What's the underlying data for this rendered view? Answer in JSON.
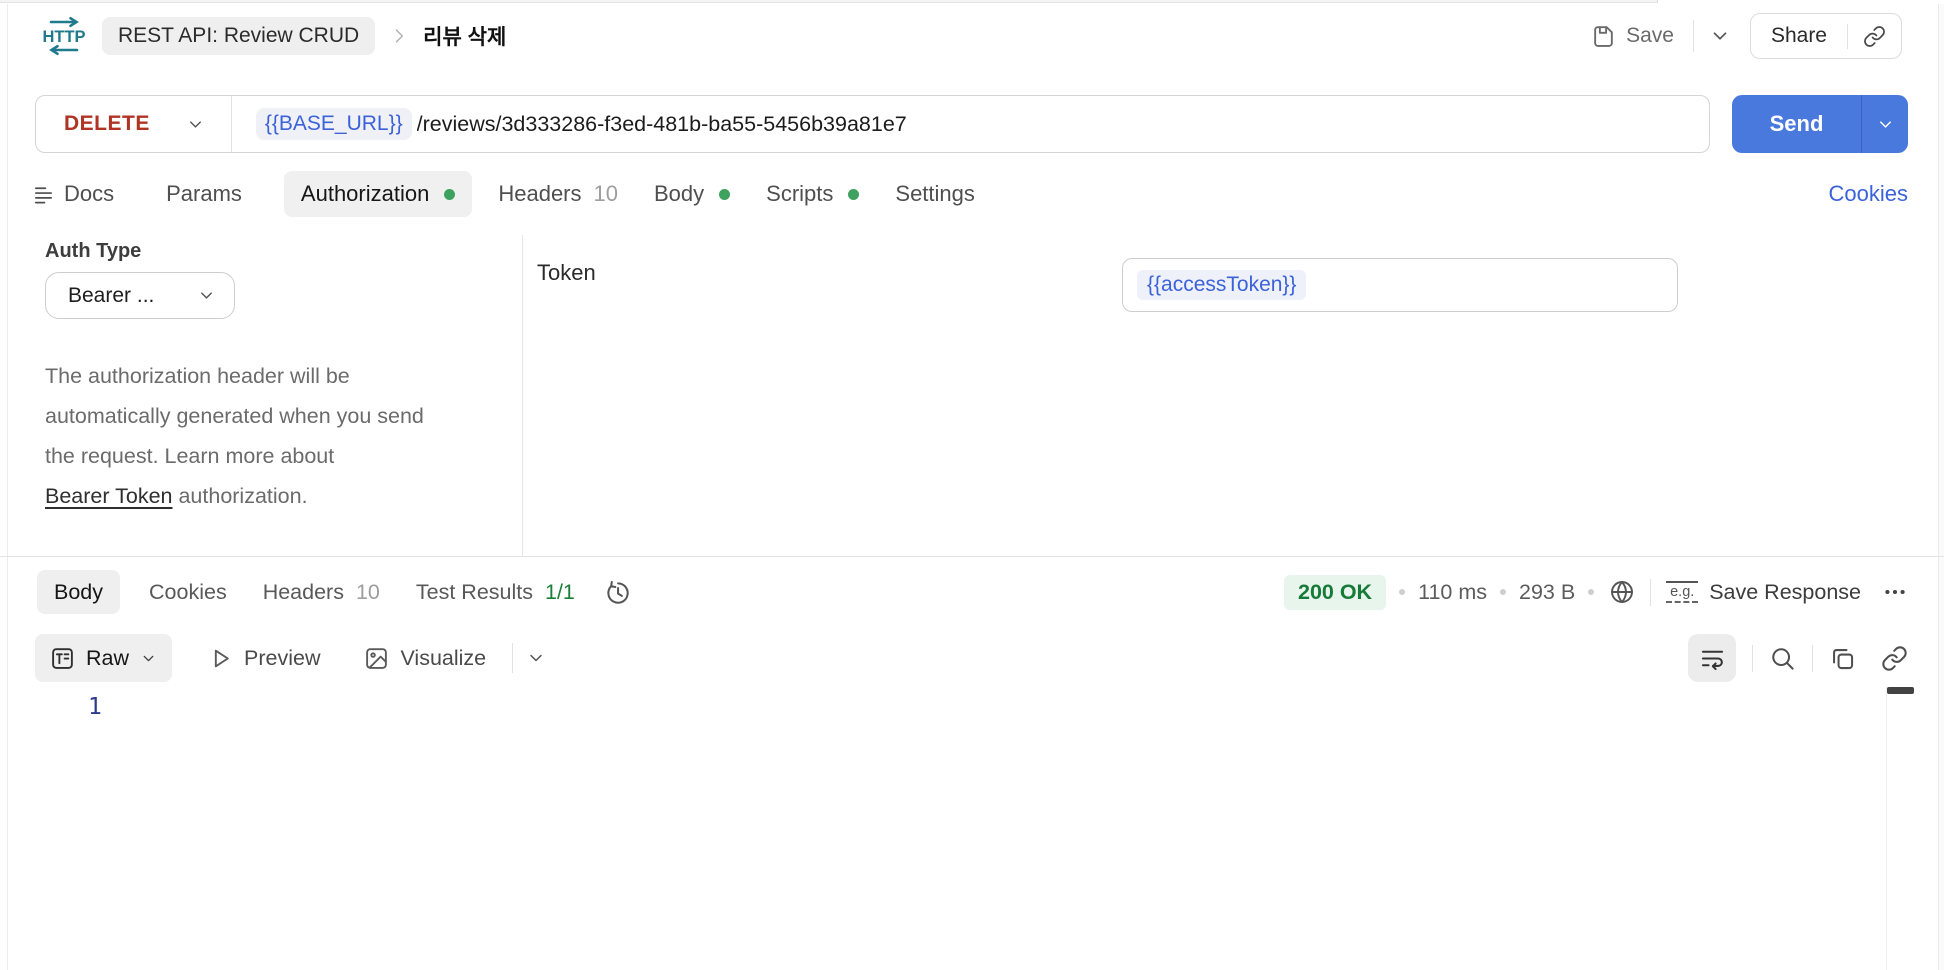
{
  "header": {
    "collection_name": "REST API: Review CRUD",
    "request_title": "리뷰 삭제",
    "save_label": "Save",
    "share_label": "Share"
  },
  "request": {
    "method": "DELETE",
    "url_variable": "{{BASE_URL}}",
    "url_path": "/reviews/3d333286-f3ed-481b-ba55-5456b39a81e7",
    "send_label": "Send"
  },
  "request_tabs": {
    "docs": "Docs",
    "params": "Params",
    "authorization": "Authorization",
    "headers": "Headers",
    "headers_count": "10",
    "body": "Body",
    "scripts": "Scripts",
    "settings": "Settings",
    "cookies_link": "Cookies"
  },
  "auth": {
    "type_label": "Auth Type",
    "type_value": "Bearer ...",
    "help_line1": "The authorization header will be",
    "help_line2": "automatically generated when you send",
    "help_line3": "the request. Learn more about",
    "help_link": "Bearer Token",
    "help_line4_rest": " authorization.",
    "token_label": "Token",
    "token_value": "{{accessToken}}"
  },
  "response": {
    "tab_body": "Body",
    "tab_cookies": "Cookies",
    "tab_headers": "Headers",
    "headers_count": "10",
    "tab_test_results": "Test Results",
    "test_ratio": "1/1",
    "status": "200 OK",
    "time": "110 ms",
    "size": "293 B",
    "eg_label": "e.g.",
    "save_response_label": "Save Response",
    "view_raw": "Raw",
    "view_preview": "Preview",
    "view_visualize": "Visualize",
    "line_number": "1"
  },
  "colors": {
    "accent_blue": "#4a79dd",
    "link_blue": "#3b62d9",
    "method_delete_red": "#b03324",
    "success_green": "#3fa15f",
    "status_green_text": "#187a38",
    "status_green_bg": "#e8f5ed",
    "http_icon_teal": "#1f7a8c",
    "line_number_navy": "#2d3a8c",
    "active_pill_bg": "#f0f0f0"
  }
}
